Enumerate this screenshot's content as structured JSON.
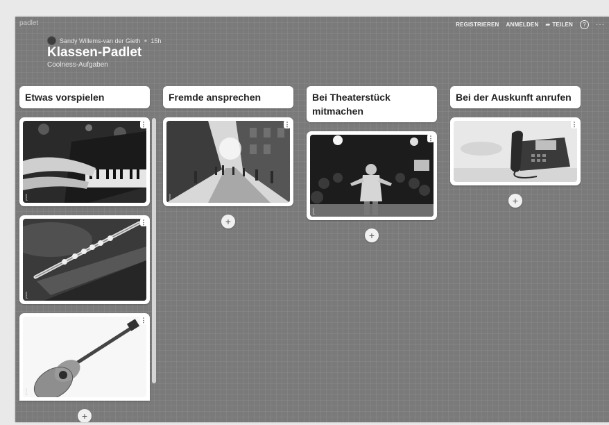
{
  "app": {
    "brand": "padlet"
  },
  "nav": {
    "register": "REGISTRIEREN",
    "login": "ANMELDEN",
    "share": "TEILEN",
    "help": "?",
    "more": "···"
  },
  "board": {
    "author": "Sandy Willems-van der Gieth",
    "time": "15h",
    "title": "Klassen-Padlet",
    "subtitle": "Coolness-Aufgaben"
  },
  "columns": [
    {
      "title": "Etwas vorspielen"
    },
    {
      "title": "Fremde ansprechen"
    },
    {
      "title": "Bei Theaterstück mitmachen"
    },
    {
      "title": "Bei der Auskunft anrufen"
    }
  ],
  "card_menu_glyph": "⋮",
  "add_glyph": "+",
  "icons": {
    "share": "share-arrow-icon",
    "help": "help-circle-icon",
    "more": "more-dots-icon",
    "card_menu": "vertical-dots-icon",
    "add": "plus-icon"
  },
  "colors": {
    "background": "#7a7a7a",
    "card": "#ffffff",
    "header_text": "#222222"
  }
}
